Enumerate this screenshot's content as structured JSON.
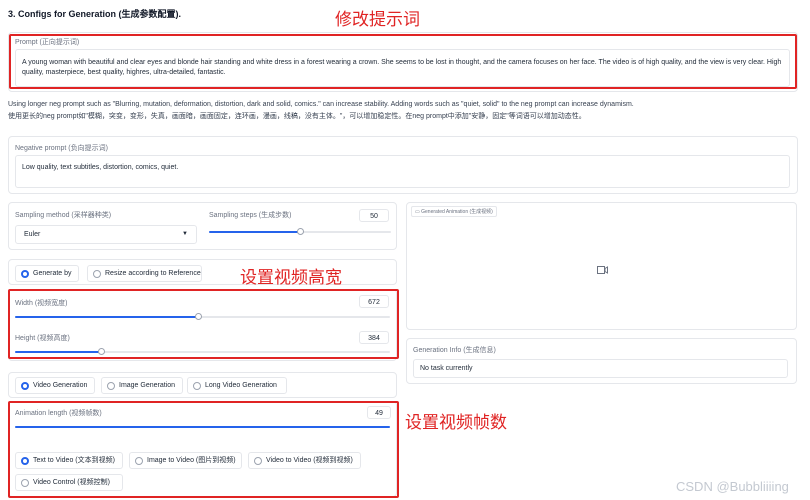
{
  "section_title": "3. Configs for Generation (生成参数配置).",
  "annotations": {
    "modify_prompt": "修改提示词",
    "set_size": "设置视频高宽",
    "set_frames": "设置视频帧数"
  },
  "prompt": {
    "label": "Prompt (正向提示词)",
    "value": "A young woman with beautiful and clear eyes and blonde hair standing and white dress in a forest wearing a crown. She seems to be lost in thought, and the camera focuses on her face. The video is of high quality, and the view is very clear. High quality, masterpiece, best quality, highres, ultra-detailed, fantastic."
  },
  "note_en": "Using longer neg prompt such as \"Blurring, mutation, deformation, distortion, dark and solid, comics.\" can increase stability. Adding words such as \"quiet, solid\" to the neg prompt can increase dynamism.",
  "note_zh": "使用更长的neg prompt如\"模糊，突变，变形，失真，画面暗，画面固定，连环画，漫画，线稿，没有主体。\"，可以增加稳定性。在neg prompt中添加\"安静，固定\"等词语可以增加动态性。",
  "negative_prompt": {
    "label": "Negative prompt (负向提示词)",
    "value": "Low quality, text subtitles, distortion, comics, quiet."
  },
  "sampling_method": {
    "label": "Sampling method (采样器种类)",
    "value": "Euler"
  },
  "sampling_steps": {
    "label": "Sampling steps (生成步数)",
    "value": "50",
    "fraction": 0.5
  },
  "resize_mode": {
    "options": [
      "Generate by",
      "Resize according to Reference"
    ],
    "selected": 0
  },
  "width": {
    "label": "Width (视频宽度)",
    "value": "672",
    "fraction": 0.49
  },
  "height": {
    "label": "Height (视频高度)",
    "value": "384",
    "fraction": 0.23
  },
  "generation_type": {
    "options": [
      "Video Generation",
      "Image Generation",
      "Long Video Generation"
    ],
    "selected": 0
  },
  "animation_length": {
    "label": "Animation length (视频帧数)",
    "value": "49",
    "fraction": 1.0
  },
  "mode": {
    "options": [
      "Text to Video (文本到视频)",
      "Image to Video (图片到视频)",
      "Video to Video (视频到视频)",
      "Video Control (视频控制)"
    ],
    "selected": 0
  },
  "generated_animation": {
    "label": "Generated Animation (生成视频)"
  },
  "generation_info": {
    "label": "Generation Info (生成信息)",
    "value": "No task currently"
  },
  "watermark": "CSDN @Bubbliiiing",
  "colors": {
    "accent": "#2563eb",
    "annotation": "#e02424"
  }
}
